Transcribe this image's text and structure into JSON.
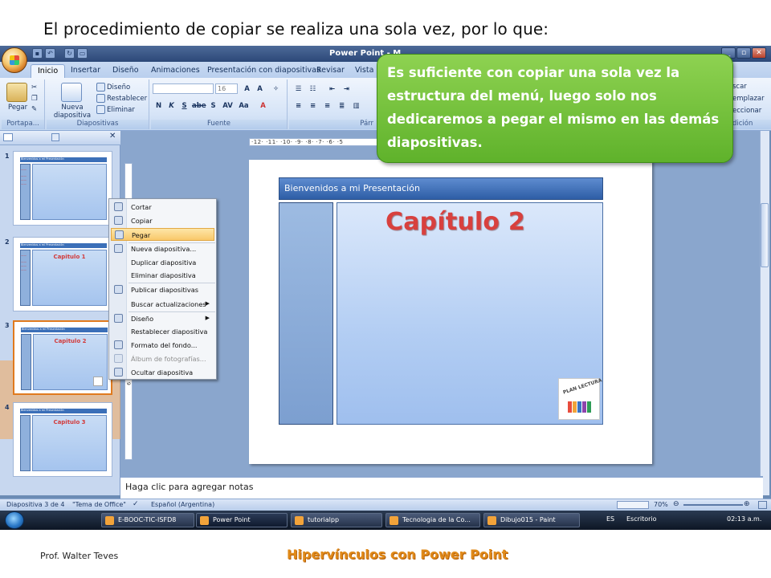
{
  "heading": "El procedimiento de copiar se realiza una sola vez, por lo que:",
  "window": {
    "title": "Power Point - M",
    "min": "_",
    "restore": "▫",
    "close": "✕"
  },
  "ribbon_tabs": [
    "Inicio",
    "Insertar",
    "Diseño",
    "Animaciones",
    "Presentación con diapositivas",
    "Revisar",
    "Vista"
  ],
  "ribbon": {
    "clipboard": {
      "paste": "Pegar",
      "label": "Portapa..."
    },
    "slides": {
      "new_slide": "Nueva diapositiva",
      "layout": "Diseño",
      "reset": "Restablecer",
      "delete": "Eliminar",
      "label": "Diapositivas"
    },
    "font": {
      "size": "16",
      "label": "Fuente"
    },
    "paragraph": {
      "label": "Párr"
    },
    "editing": {
      "find": "scar",
      "replace": "emplazar",
      "select": "eccionar",
      "label": "dición"
    }
  },
  "slides": [
    {
      "num": "1",
      "title": "",
      "header": "Bienvenidos a mi Presentación"
    },
    {
      "num": "2",
      "title": "Capitulo 1",
      "header": "Bienvenidos a mi Presentación"
    },
    {
      "num": "3",
      "title": "Capitulo 2",
      "header": "Bienvenidos a mi Presentación"
    },
    {
      "num": "4",
      "title": "Capitulo 3",
      "header": "Bienvenidos a mi Presentación"
    }
  ],
  "ruler_h": "·12· ·11· ·10· ·9· ·8· ·7· ·6· ·5",
  "ruler_v": "· 8 · 7 · 6 · 5 · 4 · 3 · 2 · 1 · 0 · 1 · 2 · 3 · 4 · 5 · 6 · 7 · 8 · 9",
  "main_slide": {
    "header": "Bienvenidos a mi Presentación",
    "title": "Capítulo 2",
    "logo_text": "PLAN LECTURA"
  },
  "context_menu": [
    {
      "label": "Cortar",
      "icon": "scissors-icon"
    },
    {
      "label": "Copiar",
      "icon": "copy-icon"
    },
    {
      "label": "Pegar",
      "icon": "paste-icon",
      "highlight": true
    },
    {
      "label": "Nueva diapositiva...",
      "icon": "new-slide-icon"
    },
    {
      "label": "Duplicar diapositiva",
      "icon": ""
    },
    {
      "label": "Eliminar diapositiva",
      "icon": ""
    },
    {
      "label": "Publicar diapositivas",
      "icon": "publish-icon"
    },
    {
      "label": "Buscar actualizaciones",
      "icon": "",
      "submenu": true
    },
    {
      "label": "Diseño",
      "icon": "layout-icon",
      "submenu": true
    },
    {
      "label": "Restablecer diapositiva",
      "icon": ""
    },
    {
      "label": "Formato del fondo...",
      "icon": "format-background-icon"
    },
    {
      "label": "Álbum de fotografías...",
      "icon": "photo-album-icon",
      "disabled": true
    },
    {
      "label": "Ocultar diapositiva",
      "icon": "hide-slide-icon"
    }
  ],
  "callout": "Es suficiente con copiar una sola vez la estructura del menú, luego solo nos dedicaremos a pegar el mismo en las demás diapositivas.",
  "notes_placeholder": "Haga clic para agregar notas",
  "status": {
    "slide": "Diapositiva 3 de 4",
    "theme": "\"Tema de Office\"",
    "language": "Español (Argentina)",
    "zoom": "70%"
  },
  "taskbar": {
    "items": [
      "E-BOOC-TIC-ISFD8",
      "Power Point",
      "tutorialpp",
      "Tecnologia de la Co...",
      "Dibujo015 - Paint"
    ],
    "lang": "ES",
    "desktop": "Escritorio",
    "time": "02:13 a.m."
  },
  "footer": {
    "author": "Prof. Walter Teves",
    "title": "Hipervínculos con Power Point"
  },
  "colors": {
    "accent": "#e08a1a",
    "callout": "#6ec03a",
    "capitulo": "#d8403e"
  }
}
